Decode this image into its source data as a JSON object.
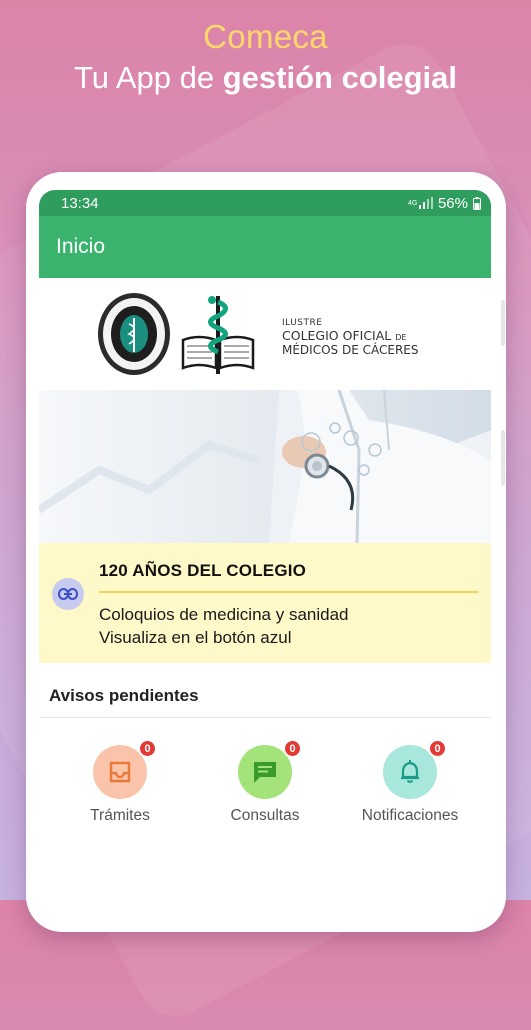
{
  "promo": {
    "line1": "Comeca",
    "line2_prefix": "Tu App de ",
    "line2_bold": "gestión colegial"
  },
  "status_bar": {
    "time": "13:34",
    "signal_label": "4G",
    "battery": "56%"
  },
  "app_bar": {
    "title": "Inicio"
  },
  "college": {
    "line1": "ILUSTRE",
    "line2": "COLEGIO OFICIAL",
    "line2_small": "DE",
    "line3": "MÉDICOS DE CÁCERES"
  },
  "info_card": {
    "title": "120 AÑOS DEL COLEGIO",
    "line1": "Coloquios de medicina y sanidad",
    "line2": "Visualiza en el botón azul",
    "icon": "link-icon"
  },
  "pending": {
    "title": "Avisos pendientes",
    "items": [
      {
        "label": "Trámites",
        "count": "0",
        "icon": "inbox-icon",
        "color": "#f9c4aa"
      },
      {
        "label": "Consultas",
        "count": "0",
        "icon": "chat-icon",
        "color": "#a4e37a"
      },
      {
        "label": "Notificaciones",
        "count": "0",
        "icon": "bell-icon",
        "color": "#a8e7dc"
      }
    ]
  },
  "colors": {
    "app_bar": "#3ab36e",
    "status_bar": "#2e9d5d",
    "accent_yellow": "#ffd86a",
    "card_bg": "#fff8c9",
    "badge": "#e53935"
  }
}
